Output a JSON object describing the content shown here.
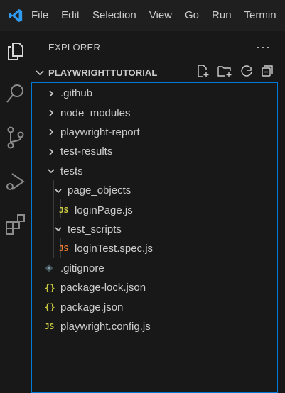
{
  "menu": [
    "File",
    "Edit",
    "Selection",
    "View",
    "Go",
    "Run",
    "Termin"
  ],
  "sidebar": {
    "title": "EXPLORER",
    "more": "···",
    "section_title": "PLAYWRIGHTTUTORIAL"
  },
  "tree": [
    {
      "label": ".github",
      "type": "folder",
      "expanded": false,
      "depth": 0
    },
    {
      "label": "node_modules",
      "type": "folder",
      "expanded": false,
      "depth": 0
    },
    {
      "label": "playwright-report",
      "type": "folder",
      "expanded": false,
      "depth": 0
    },
    {
      "label": "test-results",
      "type": "folder",
      "expanded": false,
      "depth": 0
    },
    {
      "label": "tests",
      "type": "folder",
      "expanded": true,
      "depth": 0
    },
    {
      "label": "page_objects",
      "type": "folder",
      "expanded": true,
      "depth": 1
    },
    {
      "label": "loginPage.js",
      "type": "js",
      "depth": 2,
      "icon_text": "JS"
    },
    {
      "label": "test_scripts",
      "type": "folder",
      "expanded": true,
      "depth": 1
    },
    {
      "label": "loginTest.spec.js",
      "type": "spec",
      "depth": 2,
      "icon_text": "JS"
    },
    {
      "label": ".gitignore",
      "type": "git",
      "depth": 0
    },
    {
      "label": "package-lock.json",
      "type": "json",
      "depth": 0,
      "icon_text": "{}"
    },
    {
      "label": "package.json",
      "type": "json",
      "depth": 0,
      "icon_text": "{}"
    },
    {
      "label": "playwright.config.js",
      "type": "js",
      "depth": 0,
      "icon_text": "JS"
    }
  ],
  "colors": {
    "accent": "#0078d4",
    "js": "#cbcb41",
    "spec": "#e37933"
  }
}
